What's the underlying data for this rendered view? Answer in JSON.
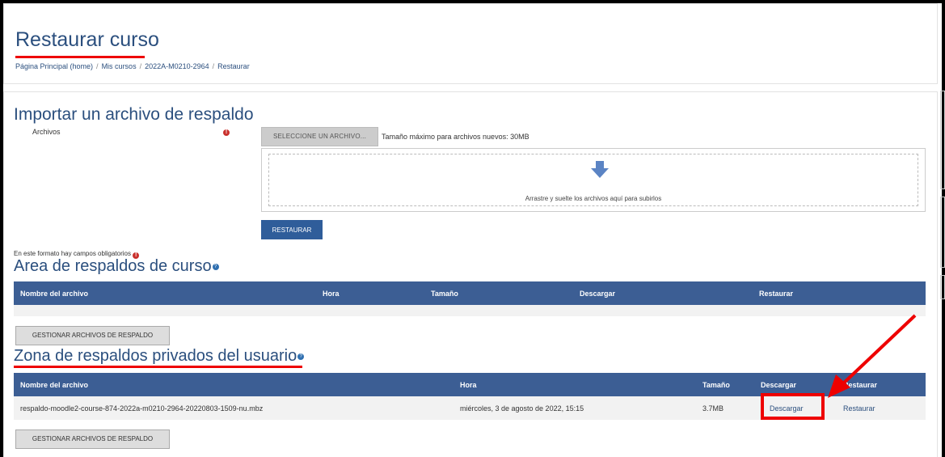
{
  "page": {
    "title": "Restaurar curso",
    "breadcrumb": [
      "Página Principal (home)",
      "Mis cursos",
      "2022A-M0210-2964",
      "Restaurar"
    ]
  },
  "import_section": {
    "heading": "Importar un archivo de respaldo",
    "files_label": "Archivos",
    "select_button": "SELECCIONE UN ARCHIVO...",
    "max_size": "Tamaño máximo para archivos nuevos: 30MB",
    "drop_text": "Arrastre y suelte los archivos aquí para subirlos",
    "restore_button": "RESTAURAR",
    "required_note": "En este formato hay campos obligatorios"
  },
  "course_backup_area": {
    "heading": "Area de respaldos de curso",
    "columns": [
      "Nombre del archivo",
      "Hora",
      "Tamaño",
      "Descargar",
      "Restaurar"
    ],
    "manage_button": "GESTIONAR ARCHIVOS DE RESPALDO"
  },
  "user_private_zone": {
    "heading": "Zona de respaldos privados del usuario",
    "columns": [
      "Nombre del archivo",
      "Hora",
      "Tamaño",
      "Descargar",
      "Restaurar"
    ],
    "rows": [
      {
        "filename": "respaldo-moodle2-course-874-2022a-m0210-2964-20220803-1509-nu.mbz",
        "time": "miércoles, 3 de agosto de 2022, 15:15",
        "size": "3.7MB",
        "download": "Descargar",
        "restore": "Restaurar"
      }
    ],
    "manage_button": "GESTIONAR ARCHIVOS DE RESPALDO"
  },
  "icons": {
    "required": "exclamation-circle-icon",
    "help": "question-circle-icon",
    "upload": "down-arrow-icon"
  },
  "colors": {
    "table_header": "#3c5e94",
    "annotation": "#e00000",
    "title": "#2b4f7e"
  }
}
